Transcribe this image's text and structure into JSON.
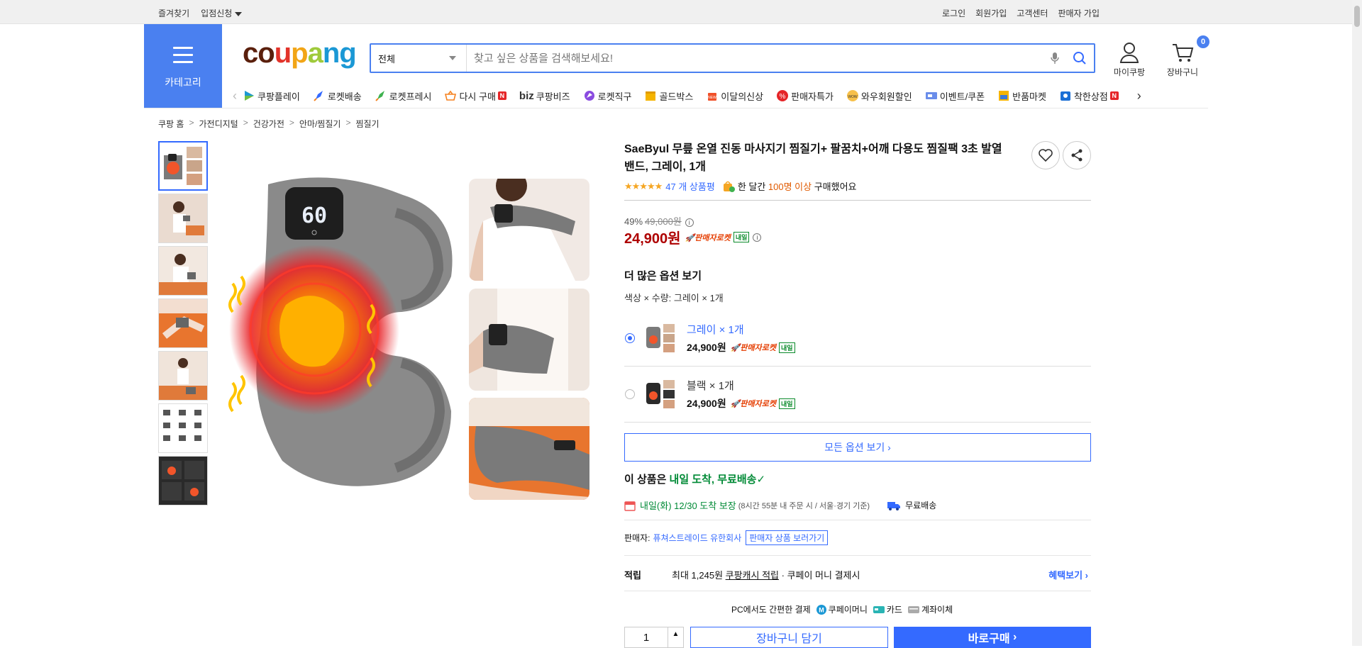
{
  "topbar": {
    "left": [
      "즐겨찾기",
      "입점신청"
    ],
    "right": [
      "로그인",
      "회원가입",
      "고객센터",
      "판매자 가입"
    ]
  },
  "header": {
    "category_label": "카테고리",
    "logo": "coupang",
    "search": {
      "scope": "전체",
      "placeholder": "찾고 싶은 상품을 검색해보세요!"
    },
    "mycoupang": "마이쿠팡",
    "cart": {
      "label": "장바구니",
      "count": "0"
    }
  },
  "nav": [
    "쿠팡플레이",
    "로켓배송",
    "로켓프레시",
    "다시 구매",
    "쿠팡비즈",
    "로켓직구",
    "골드박스",
    "이달의신상",
    "판매자특가",
    "와우회원할인",
    "이벤트/쿠폰",
    "반품마켓",
    "착한상점"
  ],
  "nav_biz": "biz",
  "breadcrumb": [
    "쿠팡 홈",
    "가전디지털",
    "건강가전",
    "안마/찜질기",
    "찜질기"
  ],
  "product": {
    "title": "SaeByul 무릎 온열 진동 마사지기 찜질기+ 팔꿈치+어깨 다용도 찜질팩 3초 발열 밴드, 그레이, 1개",
    "review_count": "47 개 상품평",
    "purchase_prefix": "한 달간 ",
    "purchase_count": "100명 이상",
    "purchase_suffix": " 구매했어요",
    "display_number": "60",
    "discount": "49%",
    "original_price": "49,000원",
    "price": "24,900원",
    "rocket_label": "판매자로켓",
    "tomorrow": "내일"
  },
  "options": {
    "heading": "더 많은 옵션 보기",
    "summary": "색상 × 수량: 그레이 × 1개",
    "items": [
      {
        "name": "그레이 × 1개",
        "price": "24,900원"
      },
      {
        "name": "블랙 × 1개",
        "price": "24,900원"
      }
    ],
    "all_button": "모든 옵션 보기"
  },
  "delivery": {
    "prefix": "이 상품은 ",
    "highlight": "내일 도착, 무료배송",
    "date": "내일(화) 12/30 도착 보장",
    "condition": "(8시간 55분 내 주문 시 / 서울·경기 기준)",
    "free": "무료배송"
  },
  "seller": {
    "label": "판매자:",
    "name": "퓨쳐스트레이드 유한회사",
    "link": "판매자 상품 보러가기"
  },
  "points": {
    "label": "적립",
    "text_prefix": "최대 1,245원 ",
    "cash": "쿠팡캐시 적립",
    "text_suffix": " · 쿠페이 머니 결제시",
    "benefit": "혜택보기"
  },
  "payment": {
    "intro": "PC에서도 간편한 결제",
    "methods": [
      "쿠페이머니",
      "카드",
      "계좌이체"
    ]
  },
  "purchase": {
    "quantity": "1",
    "cart_button": "장바구니 담기",
    "buy_button": "바로구매"
  },
  "colors": {
    "brand_blue": "#346aff",
    "category_blue": "#4a80f0",
    "price_red": "#ae0000",
    "green": "#008a36"
  }
}
